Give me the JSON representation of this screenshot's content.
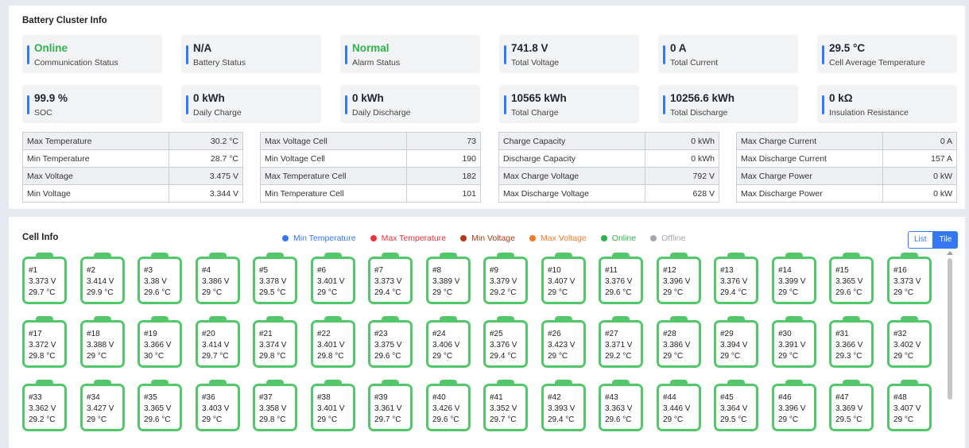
{
  "cluster": {
    "title": "Battery Cluster Info",
    "stats": [
      {
        "value": "Online",
        "label": "Communication Status",
        "green": true
      },
      {
        "value": "N/A",
        "label": "Battery Status",
        "green": false
      },
      {
        "value": "Normal",
        "label": "Alarm Status",
        "green": true
      },
      {
        "value": "741.8 V",
        "label": "Total Voltage",
        "green": false
      },
      {
        "value": "0 A",
        "label": "Total Current",
        "green": false
      },
      {
        "value": "29.5 °C",
        "label": "Cell Average Temperature",
        "green": false
      },
      {
        "value": "99.9 %",
        "label": "SOC",
        "green": false
      },
      {
        "value": "0 kWh",
        "label": "Daily Charge",
        "green": false
      },
      {
        "value": "0 kWh",
        "label": "Daily Discharge",
        "green": false
      },
      {
        "value": "10565 kWh",
        "label": "Total Charge",
        "green": false
      },
      {
        "value": "10256.6 kWh",
        "label": "Total Discharge",
        "green": false
      },
      {
        "value": "0 kΩ",
        "label": "Insulation Resistance",
        "green": false
      }
    ],
    "tables": [
      [
        [
          "Max Temperature",
          "30.2 °C"
        ],
        [
          "Min Temperature",
          "28.7 °C"
        ],
        [
          "Max Voltage",
          "3.475 V"
        ],
        [
          "Min Voltage",
          "3.344 V"
        ]
      ],
      [
        [
          "Max Voltage Cell",
          "73"
        ],
        [
          "Min Voltage Cell",
          "190"
        ],
        [
          "Max Temperature Cell",
          "182"
        ],
        [
          "Min Temperature Cell",
          "101"
        ]
      ],
      [
        [
          "Charge Capacity",
          "0 kWh"
        ],
        [
          "Discharge Capacity",
          "0 kWh"
        ],
        [
          "Max Charge Voltage",
          "792 V"
        ],
        [
          "Max Discharge Voltage",
          "628 V"
        ]
      ],
      [
        [
          "Max Charge Current",
          "0 A"
        ],
        [
          "Max Discharge Current",
          "157 A"
        ],
        [
          "Max Charge Power",
          "0 kW"
        ],
        [
          "Max Discharge Power",
          "0 kW"
        ]
      ]
    ]
  },
  "cell_info": {
    "title": "Cell Info",
    "legend": [
      {
        "label": "Min Temperature",
        "color": "#3478f6",
        "text_color": "#3478f6"
      },
      {
        "label": "Max Temperature",
        "color": "#e8353e",
        "text_color": "#e8353e"
      },
      {
        "label": "Min Voltage",
        "color": "#b33a14",
        "text_color": "#b33a14"
      },
      {
        "label": "Max Voltage",
        "color": "#f07a2a",
        "text_color": "#f07a2a"
      },
      {
        "label": "Online",
        "color": "#2fb24d",
        "text_color": "#2fb24d"
      },
      {
        "label": "Offline",
        "color": "#a3a6ab",
        "text_color": "#a3a6ab"
      }
    ],
    "view_toggle": {
      "list": "List",
      "tile": "Tile"
    },
    "cells": [
      {
        "id": "#1",
        "voltage": "3.373 V",
        "temp": "29.7 °C"
      },
      {
        "id": "#2",
        "voltage": "3.414 V",
        "temp": "29.9 °C"
      },
      {
        "id": "#3",
        "voltage": "3.38 V",
        "temp": "29.6 °C"
      },
      {
        "id": "#4",
        "voltage": "3.386 V",
        "temp": "29 °C"
      },
      {
        "id": "#5",
        "voltage": "3.378 V",
        "temp": "29.5 °C"
      },
      {
        "id": "#6",
        "voltage": "3.401 V",
        "temp": "29 °C"
      },
      {
        "id": "#7",
        "voltage": "3.373 V",
        "temp": "29.4 °C"
      },
      {
        "id": "#8",
        "voltage": "3.389 V",
        "temp": "29 °C"
      },
      {
        "id": "#9",
        "voltage": "3.379 V",
        "temp": "29.2 °C"
      },
      {
        "id": "#10",
        "voltage": "3.407 V",
        "temp": "29 °C"
      },
      {
        "id": "#11",
        "voltage": "3.376 V",
        "temp": "29.6 °C"
      },
      {
        "id": "#12",
        "voltage": "3.396 V",
        "temp": "29 °C"
      },
      {
        "id": "#13",
        "voltage": "3.376 V",
        "temp": "29.4 °C"
      },
      {
        "id": "#14",
        "voltage": "3.399 V",
        "temp": "29 °C"
      },
      {
        "id": "#15",
        "voltage": "3.365 V",
        "temp": "29.6 °C"
      },
      {
        "id": "#16",
        "voltage": "3.373 V",
        "temp": "29 °C"
      },
      {
        "id": "#17",
        "voltage": "3.372 V",
        "temp": "29.8 °C"
      },
      {
        "id": "#18",
        "voltage": "3.388 V",
        "temp": "29 °C"
      },
      {
        "id": "#19",
        "voltage": "3.366 V",
        "temp": "30 °C"
      },
      {
        "id": "#20",
        "voltage": "3.414 V",
        "temp": "29.7 °C"
      },
      {
        "id": "#21",
        "voltage": "3.374 V",
        "temp": "29.8 °C"
      },
      {
        "id": "#22",
        "voltage": "3.401 V",
        "temp": "29.8 °C"
      },
      {
        "id": "#23",
        "voltage": "3.375 V",
        "temp": "29.6 °C"
      },
      {
        "id": "#24",
        "voltage": "3.406 V",
        "temp": "29 °C"
      },
      {
        "id": "#25",
        "voltage": "3.376 V",
        "temp": "29.4 °C"
      },
      {
        "id": "#26",
        "voltage": "3.423 V",
        "temp": "29 °C"
      },
      {
        "id": "#27",
        "voltage": "3.371 V",
        "temp": "29.2 °C"
      },
      {
        "id": "#28",
        "voltage": "3.386 V",
        "temp": "29 °C"
      },
      {
        "id": "#29",
        "voltage": "3.394 V",
        "temp": "29 °C"
      },
      {
        "id": "#30",
        "voltage": "3.391 V",
        "temp": "29 °C"
      },
      {
        "id": "#31",
        "voltage": "3.366 V",
        "temp": "29.3 °C"
      },
      {
        "id": "#32",
        "voltage": "3.402 V",
        "temp": "29 °C"
      },
      {
        "id": "#33",
        "voltage": "3.362 V",
        "temp": "29.2 °C"
      },
      {
        "id": "#34",
        "voltage": "3.427 V",
        "temp": "29 °C"
      },
      {
        "id": "#35",
        "voltage": "3.365 V",
        "temp": "29.6 °C"
      },
      {
        "id": "#36",
        "voltage": "3.403 V",
        "temp": "29 °C"
      },
      {
        "id": "#37",
        "voltage": "3.358 V",
        "temp": "29.8 °C"
      },
      {
        "id": "#38",
        "voltage": "3.401 V",
        "temp": "29 °C"
      },
      {
        "id": "#39",
        "voltage": "3.361 V",
        "temp": "29.7 °C"
      },
      {
        "id": "#40",
        "voltage": "3.426 V",
        "temp": "29.6 °C"
      },
      {
        "id": "#41",
        "voltage": "3.352 V",
        "temp": "29.7 °C"
      },
      {
        "id": "#42",
        "voltage": "3.393 V",
        "temp": "29.4 °C"
      },
      {
        "id": "#43",
        "voltage": "3.363 V",
        "temp": "29.6 °C"
      },
      {
        "id": "#44",
        "voltage": "3.446 V",
        "temp": "29 °C"
      },
      {
        "id": "#45",
        "voltage": "3.364 V",
        "temp": "29.5 °C"
      },
      {
        "id": "#46",
        "voltage": "3.396 V",
        "temp": "29 °C"
      },
      {
        "id": "#47",
        "voltage": "3.369 V",
        "temp": "29.5 °C"
      },
      {
        "id": "#48",
        "voltage": "3.407 V",
        "temp": "29 °C"
      }
    ]
  }
}
